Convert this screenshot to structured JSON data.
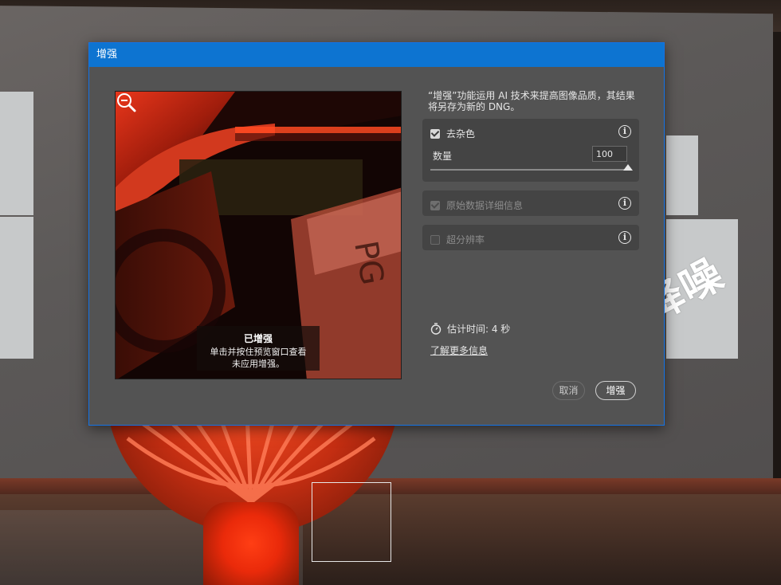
{
  "overlay_caption": "降噪",
  "dialog": {
    "title": "增强",
    "description": "“增强”功能运用 AI 技术来提高图像品质，其结果将另存为新的 DNG。",
    "preview": {
      "status_title": "已增强",
      "status_desc_line1": "单击并按住预览窗口查看",
      "status_desc_line2": "未应用增强。",
      "zoom_icon": "zoom-out-icon"
    },
    "options": {
      "denoise": {
        "label": "去杂色",
        "checked": true,
        "amount_label": "数量",
        "amount_value": "100",
        "amount_fraction": 1.0
      },
      "raw_details": {
        "label": "原始数据详细信息",
        "checked": true,
        "disabled": true
      },
      "super_resolution": {
        "label": "超分辨率",
        "checked": false,
        "disabled": true
      }
    },
    "estimate": {
      "icon": "stopwatch-icon",
      "text": "估计时间: 4 秒"
    },
    "learn_more": "了解更多信息",
    "buttons": {
      "cancel": "取消",
      "enhance": "增强"
    }
  },
  "colors": {
    "titlebar": "#0d74d1",
    "dialog_bg": "#535353",
    "panel_bg": "#444444"
  }
}
